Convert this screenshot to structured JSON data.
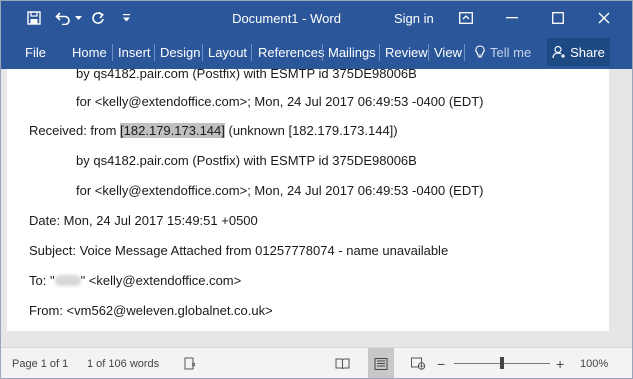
{
  "window": {
    "title": "Document1 - Word",
    "sign_in": "Sign in"
  },
  "ribbon": {
    "tabs": [
      {
        "label": "File"
      },
      {
        "label": "Home"
      },
      {
        "label": "Insert"
      },
      {
        "label": "Design"
      },
      {
        "label": "Layout"
      },
      {
        "label": "References"
      },
      {
        "label": "Mailings"
      },
      {
        "label": "Review"
      },
      {
        "label": "View"
      }
    ],
    "tell_me": "Tell me",
    "share": "Share"
  },
  "document": {
    "lines": [
      {
        "text": "by qs4182.pair.com (Postfix) with ESMTP id 375DE98006B"
      },
      {
        "text": "for <kelly@extendoffice.com>; Mon, 24 Jul 2017 06:49:53 -0400 (EDT)"
      },
      {
        "prefix": "Received: from ",
        "highlight": "[182.179.173.144]",
        "suffix": " (unknown [182.179.173.144])"
      },
      {
        "text": "by qs4182.pair.com (Postfix) with ESMTP id 375DE98006B"
      },
      {
        "text": "for <kelly@extendoffice.com>; Mon, 24 Jul 2017 06:49:53 -0400 (EDT)"
      },
      {
        "text": "Date: Mon, 24 Jul 2017 15:49:51 +0500"
      },
      {
        "text": "Subject: Voice Message Attached from 01257778074 - name unavailable"
      },
      {
        "prefix": "To: \"",
        "suffix": "\" <kelly@extendoffice.com>"
      },
      {
        "text": "From: <vm562@weleven.globalnet.co.uk>"
      }
    ]
  },
  "status": {
    "page": "Page 1 of 1",
    "words": "1 of 106 words",
    "zoom": "100%",
    "zoom_minus": "−",
    "zoom_plus": "+"
  },
  "colors": {
    "ribbon": "#2b579a",
    "share_button": "#1e4a84",
    "highlight": "#c0c0c0"
  }
}
